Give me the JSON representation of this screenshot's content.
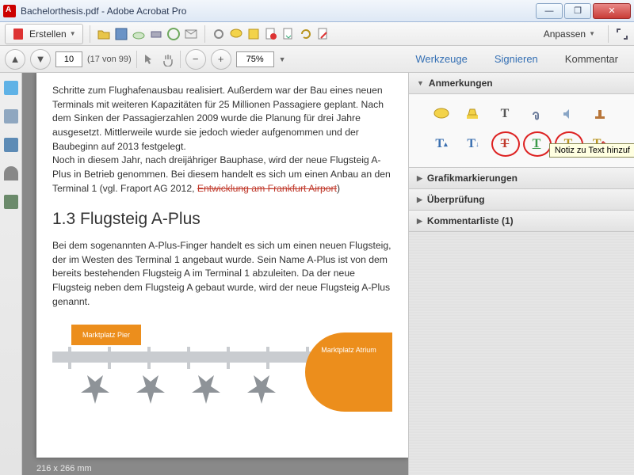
{
  "window": {
    "title": "Bachelorthesis.pdf - Adobe Acrobat Pro"
  },
  "menubar": {
    "create": "Erstellen",
    "customize": "Anpassen"
  },
  "toolbar": {
    "page_current": "10",
    "page_total": "(17 von 99)",
    "zoom": "75%",
    "tab_tools": "Werkzeuge",
    "tab_sign": "Signieren",
    "tab_comment": "Kommentar"
  },
  "document": {
    "para1": "Schritte zum Flughafenausbau realisiert. Außerdem war der Bau eines neuen Terminals mit weiteren Kapazitäten für 25 Millionen Passagiere geplant. Nach dem Sinken der Passagierzahlen 2009 wurde die Planung für drei Jahre ausgesetzt. Mittlerweile wurde sie jedoch wieder aufgenommen und der Baubeginn auf 2013 festgelegt.",
    "para2a": "Noch in diesem Jahr, nach dreijähriger Bauphase, wird der neue Flugsteig A-Plus in Betrieb genommen. Bei diesem handelt es sich um einen Anbau an den Terminal 1 (vgl. Fraport AG 2012, ",
    "para2_strike": "Entwicklung am Frankfurt Airport",
    "para2b": ")",
    "heading": "1.3 Flugsteig A-Plus",
    "para3": "Bei dem sogenannten A-Plus-Finger handelt es sich um einen neuen Flugsteig, der im Westen des Terminal 1 angebaut wurde. Sein Name A-Plus ist von dem bereits bestehenden Flugsteig A im Terminal 1 abzuleiten. Da der neue Flugsteig neben dem Flugsteig A gebaut wurde, wird der neue Flugsteig A-Plus genannt.",
    "diag_pier": "Marktplatz Pier",
    "diag_atrium": "Marktplatz\nAtrium",
    "page_dims": "216 x 266 mm"
  },
  "panel": {
    "annotations": "Anmerkungen",
    "graphic_markup": "Grafikmarkierungen",
    "review": "Überprüfung",
    "comment_list": "Kommentarliste (1)",
    "tooltip": "Notiz zu Text hinzuf"
  }
}
